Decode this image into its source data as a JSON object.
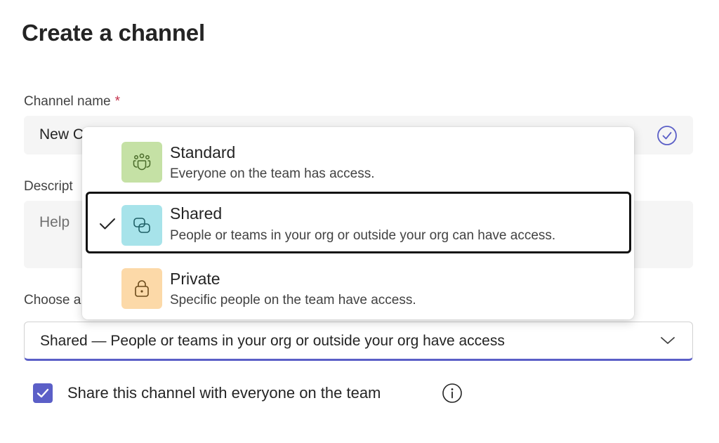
{
  "dialog": {
    "title": "Create a channel"
  },
  "channel_name": {
    "label": "Channel name",
    "required_mark": "*",
    "value": "New C"
  },
  "description": {
    "label": "Descript",
    "placeholder": "Help"
  },
  "privacy": {
    "label": "Choose a",
    "selected_value": "Shared — People or teams in your org or outside your org have access",
    "options": [
      {
        "title": "Standard",
        "description": "Everyone on the team has access.",
        "icon": "people-icon",
        "color": "#c5e1a5",
        "selected": false
      },
      {
        "title": "Shared",
        "description": "People or teams in your org or outside your org can have access.",
        "icon": "shared-link-icon",
        "color": "#a7e3ea",
        "selected": true
      },
      {
        "title": "Private",
        "description": "Specific people on the team have access.",
        "icon": "lock-icon",
        "color": "#fcd9a8",
        "selected": false
      }
    ]
  },
  "share_with_team": {
    "label": "Share this channel with everyone on the team",
    "checked": true
  },
  "colors": {
    "accent": "#5b5fc7",
    "required": "#c4314b"
  }
}
